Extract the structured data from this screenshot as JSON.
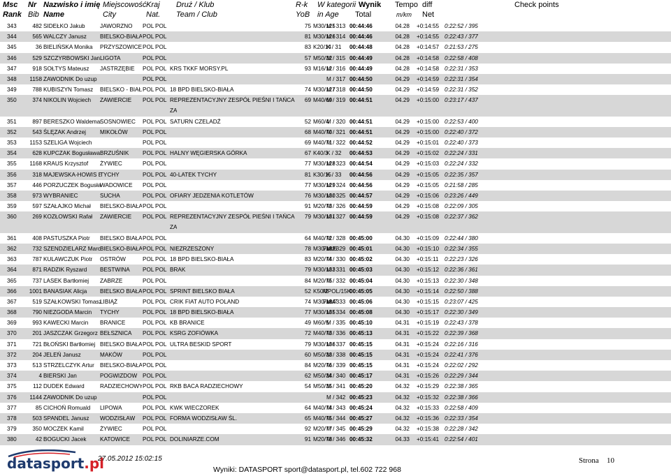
{
  "header": {
    "msc": "Msc",
    "nr": "Nr",
    "nazwisko": "Nazwisko i imię",
    "miejscowosc": "Miejscowość",
    "kraj": "Kraj",
    "druz": "Druż / Klub",
    "rk": "R-k",
    "wkat": "W kategorii",
    "wynik": "Wynik",
    "tempo": "Tempo",
    "diff": "diff",
    "check": "Check points",
    "rank": "Rank",
    "bib": "Bib",
    "name": "Name",
    "city": "City",
    "nat": "Nat.",
    "team": "Team / Club",
    "yob": "YoB",
    "inage": "in Age",
    "total": "Total",
    "mkm": "m/km",
    "net": "Net"
  },
  "rows": [
    {
      "rank": "343",
      "bib": "482",
      "name": "SIDEŁKO Jakub",
      "city": "JAWORZNO",
      "nat1": "POL",
      "nat2": "POL",
      "team": "",
      "team2": "",
      "yob": "75",
      "cat": "M30/125",
      "fiat": "",
      "age": "M / 313",
      "total": "00:44:46",
      "tempo": "04.28",
      "diff": "+0:14:55",
      "net": "0:22:52 / 395"
    },
    {
      "rank": "344",
      "bib": "565",
      "name": "WALCZY Janusz",
      "city": "BIELSKO-BIAŁA",
      "nat1": "POL",
      "nat2": "POL",
      "team": "",
      "team2": "",
      "yob": "81",
      "cat": "M30/126",
      "fiat": "",
      "age": "M / 314",
      "total": "00:44:46",
      "tempo": "04.28",
      "diff": "+0:14:55",
      "net": "0:22:43 / 377"
    },
    {
      "rank": "345",
      "bib": "36",
      "name": "BIELIŃSKA Monika",
      "city": "PRZYSZOWICE",
      "nat1": "POL",
      "nat2": "POL",
      "team": "",
      "team2": "",
      "yob": "83",
      "cat": "K20/14",
      "fiat": "",
      "age": "K / 31",
      "total": "00:44:48",
      "tempo": "04.28",
      "diff": "+0:14:57",
      "net": "0:21:53 / 275"
    },
    {
      "rank": "346",
      "bib": "529",
      "name": "SZCZYRBOWSKI Jan",
      "city": "LIGOTA",
      "nat1": "POL",
      "nat2": "POL",
      "team": "",
      "team2": "",
      "yob": "57",
      "cat": "M50/32",
      "fiat": "",
      "age": "M / 315",
      "total": "00:44:49",
      "tempo": "04.28",
      "diff": "+0:14:58",
      "net": "0:22:58 / 408"
    },
    {
      "rank": "347",
      "bib": "918",
      "name": "SOŁTYS Mateusz",
      "city": "JASTRZĘBIE",
      "nat1": "POL",
      "nat2": "POL",
      "team": "KRS TKKF MORSY.PL",
      "team2": "",
      "yob": "93",
      "cat": "M16/12",
      "fiat": "",
      "age": "M / 316",
      "total": "00:44:49",
      "tempo": "04.28",
      "diff": "+0:14:58",
      "net": "0:22:31 / 353"
    },
    {
      "rank": "348",
      "bib": "1158",
      "name": "ZAWODNIK Do uzup",
      "city": "",
      "nat1": "POL",
      "nat2": "POL",
      "team": "",
      "team2": "",
      "yob": "",
      "cat": "",
      "fiat": "",
      "age": "M / 317",
      "total": "00:44:50",
      "tempo": "04.29",
      "diff": "+0:14:59",
      "net": "0:22:31 / 354"
    },
    {
      "rank": "349",
      "bib": "788",
      "name": "KUBISZYN Tomasz",
      "city": "BIELSKO - BIAŁA",
      "nat1": "POL",
      "nat2": "POL",
      "team": "18 BPD BIELSKO-BIAŁA",
      "team2": "",
      "yob": "74",
      "cat": "M30/127",
      "fiat": "",
      "age": "M / 318",
      "total": "00:44:50",
      "tempo": "04.29",
      "diff": "+0:14:59",
      "net": "0:22:31 / 352"
    },
    {
      "rank": "350",
      "bib": "374",
      "name": "NIKOLIN Wojciech",
      "city": "ZAWIERCIE",
      "nat1": "POL",
      "nat2": "POL",
      "team": "REPREZENTACYJNY ZESPÓŁ PIEŚNI I TAŃCA",
      "team2": "ZA",
      "yob": "69",
      "cat": "M40/69",
      "fiat": "",
      "age": "M / 319",
      "total": "00:44:51",
      "tempo": "04.29",
      "diff": "+0:15:00",
      "net": "0:23:17 / 437"
    },
    {
      "rank": "351",
      "bib": "897",
      "name": "BERESZKO Waldemar",
      "city": "SOSNOWIEC",
      "nat1": "POL",
      "nat2": "POL",
      "team": "SATURN CZELADŹ",
      "team2": "",
      "yob": "52",
      "cat": "M60/4",
      "fiat": "",
      "age": "M / 320",
      "total": "00:44:51",
      "tempo": "04.29",
      "diff": "+0:15:00",
      "net": "0:22:53 / 400"
    },
    {
      "rank": "352",
      "bib": "543",
      "name": "ŚLĘZAK Andrzej",
      "city": "MIKOŁÓW",
      "nat1": "POL",
      "nat2": "POL",
      "team": "",
      "team2": "",
      "yob": "68",
      "cat": "M40/70",
      "fiat": "",
      "age": "M / 321",
      "total": "00:44:51",
      "tempo": "04.29",
      "diff": "+0:15:00",
      "net": "0:22:40 / 372"
    },
    {
      "rank": "353",
      "bib": "1153",
      "name": "SZELIGA Wojciech",
      "city": "",
      "nat1": "POL",
      "nat2": "POL",
      "team": "",
      "team2": "",
      "yob": "69",
      "cat": "M40/71",
      "fiat": "",
      "age": "M / 322",
      "total": "00:44:52",
      "tempo": "04.29",
      "diff": "+0:15:01",
      "net": "0:22:40 / 373"
    },
    {
      "rank": "354",
      "bib": "628",
      "name": "KUPCZAK Bogusława",
      "city": "BRZUŚNIK",
      "nat1": "POL",
      "nat2": "POL",
      "team": "HALNY WĘGIERSKA GÓRKA",
      "team2": "",
      "yob": "67",
      "cat": "K40/3",
      "fiat": "",
      "age": "K / 32",
      "total": "00:44:53",
      "tempo": "04.29",
      "diff": "+0:15:02",
      "net": "0:22:24 / 331"
    },
    {
      "rank": "355",
      "bib": "1168",
      "name": "KRAUS Krzysztof",
      "city": "ŻYWIEC",
      "nat1": "POL",
      "nat2": "POL",
      "team": "",
      "team2": "",
      "yob": "77",
      "cat": "M30/128",
      "fiat": "",
      "age": "M / 323",
      "total": "00:44:54",
      "tempo": "04.29",
      "diff": "+0:15:03",
      "net": "0:22:24 / 332"
    },
    {
      "rank": "356",
      "bib": "318",
      "name": "MAJEWSKA-HOWIS Ewelina",
      "city": "TYCHY",
      "nat1": "POL",
      "nat2": "POL",
      "team": "40-LATEK TYCHY",
      "team2": "",
      "yob": "81",
      "cat": "K30/15",
      "fiat": "",
      "age": "K / 33",
      "total": "00:44:56",
      "tempo": "04.29",
      "diff": "+0:15:05",
      "net": "0:22:35 / 357"
    },
    {
      "rank": "357",
      "bib": "446",
      "name": "PORZUCZEK Bogusław",
      "city": "WADOWICE",
      "nat1": "POL",
      "nat2": "POL",
      "team": "",
      "team2": "",
      "yob": "77",
      "cat": "M30/129",
      "fiat": "",
      "age": "M / 324",
      "total": "00:44:56",
      "tempo": "04.29",
      "diff": "+0:15:05",
      "net": "0:21:58 / 285"
    },
    {
      "rank": "358",
      "bib": "973",
      "name": "WYBRANIEC",
      "city": "SUCHA",
      "nat1": "POL",
      "nat2": "POL",
      "team": "OFIARY JEDZENIA KOTLETÓW",
      "team2": "",
      "yob": "76",
      "cat": "M30/130",
      "fiat": "",
      "age": "M / 325",
      "total": "00:44:57",
      "tempo": "04.29",
      "diff": "+0:15:06",
      "net": "0:23:26 / 449"
    },
    {
      "rank": "359",
      "bib": "597",
      "name": "SZAŁAJKO Michał",
      "city": "BIELSKO-BIAŁA",
      "nat1": "POL",
      "nat2": "POL",
      "team": "",
      "team2": "",
      "yob": "91",
      "cat": "M20/73",
      "fiat": "",
      "age": "M / 326",
      "total": "00:44:59",
      "tempo": "04.29",
      "diff": "+0:15:08",
      "net": "0:22:09 / 305"
    },
    {
      "rank": "360",
      "bib": "269",
      "name": "KOZŁOWSKI Rafał",
      "city": "ZAWIERCIE",
      "nat1": "POL",
      "nat2": "POL",
      "team": "REPREZENTACYJNY ZESPÓŁ PIEŚNI I TAŃCA",
      "team2": "ZA",
      "yob": "79",
      "cat": "M30/131",
      "fiat": "",
      "age": "M / 327",
      "total": "00:44:59",
      "tempo": "04.29",
      "diff": "+0:15:08",
      "net": "0:22:37 / 362"
    },
    {
      "rank": "361",
      "bib": "408",
      "name": "PASTUSZKA Piotr",
      "city": "BIELSKO BIAŁA",
      "nat1": "POL",
      "nat2": "POL",
      "team": "",
      "team2": "",
      "yob": "64",
      "cat": "M40/72",
      "fiat": "",
      "age": "M / 328",
      "total": "00:45:00",
      "tempo": "04.30",
      "diff": "+0:15:09",
      "net": "0:22:44 / 380"
    },
    {
      "rank": "362",
      "bib": "732",
      "name": "SZENDZIELARZ Marcin",
      "city": "BIELSKO-BIAŁA",
      "nat1": "POL",
      "nat2": "POL",
      "team": "NIEZRZESZONY",
      "team2": "",
      "yob": "78",
      "cat": "M30/132",
      "fiat": "Fiat/6",
      "age": "M / 329",
      "total": "00:45:01",
      "tempo": "04.30",
      "diff": "+0:15:10",
      "net": "0:22:34 / 355"
    },
    {
      "rank": "363",
      "bib": "787",
      "name": "KULAWCZUK Piotr",
      "city": "OSTRÓW",
      "nat1": "POL",
      "nat2": "POL",
      "team": "18 BPD BIELSKO-BIAŁA",
      "team2": "",
      "yob": "83",
      "cat": "M20/74",
      "fiat": "",
      "age": "M / 330",
      "total": "00:45:02",
      "tempo": "04.30",
      "diff": "+0:15:11",
      "net": "0:22:23 / 326"
    },
    {
      "rank": "364",
      "bib": "871",
      "name": "RADZIK Ryszard",
      "city": "BESTWINA",
      "nat1": "POL",
      "nat2": "POL",
      "team": "BRAK",
      "team2": "",
      "yob": "79",
      "cat": "M30/133",
      "fiat": "",
      "age": "M / 331",
      "total": "00:45:03",
      "tempo": "04.30",
      "diff": "+0:15:12",
      "net": "0:22:36 / 361"
    },
    {
      "rank": "365",
      "bib": "737",
      "name": "LASEK Bartłomiej",
      "city": "ZABRZE",
      "nat1": "POL",
      "nat2": "POL",
      "team": "",
      "team2": "",
      "yob": "84",
      "cat": "M20/75",
      "fiat": "",
      "age": "M / 332",
      "total": "00:45:04",
      "tempo": "04.30",
      "diff": "+0:15:13",
      "net": "0:22:30 / 348"
    },
    {
      "rank": "366",
      "bib": "1001",
      "name": "BANASIAK Alicja",
      "city": "BIELSKO BIAŁA",
      "nat1": "POL",
      "nat2": "POL",
      "team": "SPRINT BIELSKO BIAŁA",
      "team2": "",
      "yob": "52",
      "cat": "K50/2",
      "fiat": "MPOL/15K / 34",
      "age": "",
      "total": "00:45:05",
      "tempo": "04.30",
      "diff": "+0:15:14",
      "net": "0:22:50 / 388"
    },
    {
      "rank": "367",
      "bib": "519",
      "name": "SZAŁKOWSKI Tomasz",
      "city": "LIBIĄŻ",
      "nat1": "POL",
      "nat2": "POL",
      "team": "CRIK FIAT AUTO POLAND",
      "team2": "",
      "yob": "74",
      "cat": "M30/134",
      "fiat": "Fiat/7",
      "age": "M / 333",
      "total": "00:45:06",
      "tempo": "04.30",
      "diff": "+0:15:15",
      "net": "0:23:07 / 425"
    },
    {
      "rank": "368",
      "bib": "790",
      "name": "NIEZGODA Marcin",
      "city": "TYCHY",
      "nat1": "POL",
      "nat2": "POL",
      "team": "18 BPD BIELSKO-BIAŁA",
      "team2": "",
      "yob": "77",
      "cat": "M30/135",
      "fiat": "",
      "age": "M / 334",
      "total": "00:45:08",
      "tempo": "04.30",
      "diff": "+0:15:17",
      "net": "0:22:30 / 349"
    },
    {
      "rank": "369",
      "bib": "993",
      "name": "KAWECKI Marcin",
      "city": "BRANICE",
      "nat1": "POL",
      "nat2": "POL",
      "team": "KB BRANICE",
      "team2": "",
      "yob": "49",
      "cat": "M60/5",
      "fiat": "",
      "age": "M / 335",
      "total": "00:45:10",
      "tempo": "04.31",
      "diff": "+0:15:19",
      "net": "0:22:43 / 378"
    },
    {
      "rank": "370",
      "bib": "201",
      "name": "JASZCZAK Grzegorz",
      "city": "BEŁSZNICA",
      "nat1": "POL",
      "nat2": "POL",
      "team": "KSRG ZOFIÓWKA",
      "team2": "",
      "yob": "72",
      "cat": "M40/73",
      "fiat": "",
      "age": "M / 336",
      "total": "00:45:13",
      "tempo": "04.31",
      "diff": "+0:15:22",
      "net": "0:22:39 / 368"
    },
    {
      "rank": "371",
      "bib": "721",
      "name": "BŁOŃSKI Bartłomiej",
      "city": "BIELSKO BIAŁA",
      "nat1": "POL",
      "nat2": "POL",
      "team": "ULTRA BESKID SPORT",
      "team2": "",
      "yob": "79",
      "cat": "M30/136",
      "fiat": "",
      "age": "M / 337",
      "total": "00:45:15",
      "tempo": "04.31",
      "diff": "+0:15:24",
      "net": "0:22:16 / 316"
    },
    {
      "rank": "372",
      "bib": "204",
      "name": "JELEŃ Janusz",
      "city": "MAKÓW",
      "nat1": "POL",
      "nat2": "POL",
      "team": "",
      "team2": "",
      "yob": "60",
      "cat": "M50/33",
      "fiat": "",
      "age": "M / 338",
      "total": "00:45:15",
      "tempo": "04.31",
      "diff": "+0:15:24",
      "net": "0:22:41 / 376"
    },
    {
      "rank": "373",
      "bib": "513",
      "name": "STRZELCZYK Artur",
      "city": "BIELSKO-BIAŁA",
      "nat1": "POL",
      "nat2": "POL",
      "team": "",
      "team2": "",
      "yob": "84",
      "cat": "M20/76",
      "fiat": "",
      "age": "M / 339",
      "total": "00:45:15",
      "tempo": "04.31",
      "diff": "+0:15:24",
      "net": "0:22:02 / 292"
    },
    {
      "rank": "374",
      "bib": "4",
      "name": "BIERSKI Jan",
      "city": "POGWIZDOW",
      "nat1": "POL",
      "nat2": "POL",
      "team": "",
      "team2": "",
      "yob": "62",
      "cat": "M50/34",
      "fiat": "",
      "age": "M / 340",
      "total": "00:45:17",
      "tempo": "04.31",
      "diff": "+0:15:26",
      "net": "0:22:29 / 344"
    },
    {
      "rank": "375",
      "bib": "112",
      "name": "DUDEK Edward",
      "city": "RADZIECHOWY",
      "nat1": "POL",
      "nat2": "POL",
      "team": "RKB BACA RADZIECHOWY",
      "team2": "",
      "yob": "54",
      "cat": "M50/35",
      "fiat": "",
      "age": "M / 341",
      "total": "00:45:20",
      "tempo": "04.32",
      "diff": "+0:15:29",
      "net": "0:22:38 / 365"
    },
    {
      "rank": "376",
      "bib": "1144",
      "name": "ZAWODNIK Do uzup",
      "city": "",
      "nat1": "POL",
      "nat2": "POL",
      "team": "",
      "team2": "",
      "yob": "",
      "cat": "",
      "fiat": "",
      "age": "M / 342",
      "total": "00:45:23",
      "tempo": "04.32",
      "diff": "+0:15:32",
      "net": "0:22:38 / 366"
    },
    {
      "rank": "377",
      "bib": "85",
      "name": "CICHOŃ Romuald",
      "city": "LIPOWA",
      "nat1": "POL",
      "nat2": "POL",
      "team": "KWK WIECZOREK",
      "team2": "",
      "yob": "64",
      "cat": "M40/74",
      "fiat": "",
      "age": "M / 343",
      "total": "00:45:24",
      "tempo": "04.32",
      "diff": "+0:15:33",
      "net": "0:22:58 / 409"
    },
    {
      "rank": "378",
      "bib": "503",
      "name": "SPANDEL Janusz",
      "city": "WODZISŁAW",
      "nat1": "POL",
      "nat2": "POL",
      "team": "FORMA WODZISŁAW ŚL.",
      "team2": "",
      "yob": "65",
      "cat": "M40/75",
      "fiat": "",
      "age": "M / 344",
      "total": "00:45:27",
      "tempo": "04.32",
      "diff": "+0:15:36",
      "net": "0:22:33 / 354"
    },
    {
      "rank": "379",
      "bib": "350",
      "name": "MOCZEK Kamil",
      "city": "ŻYWIEC",
      "nat1": "POL",
      "nat2": "POL",
      "team": "",
      "team2": "",
      "yob": "92",
      "cat": "M20/77",
      "fiat": "",
      "age": "M / 345",
      "total": "00:45:29",
      "tempo": "04.32",
      "diff": "+0:15:38",
      "net": "0:22:28 / 342"
    },
    {
      "rank": "380",
      "bib": "42",
      "name": "BOGUCKI Jacek",
      "city": "KATOWICE",
      "nat1": "POL",
      "nat2": "POL",
      "team": "DOLINIARZE.COM",
      "team2": "",
      "yob": "91",
      "cat": "M20/78",
      "fiat": "",
      "age": "M / 346",
      "total": "00:45:32",
      "tempo": "04.33",
      "diff": "+0:15:41",
      "net": "0:22:54 / 401"
    }
  ],
  "footer": {
    "logo_main": "datasport",
    "logo_dot": ".pl",
    "timestamp": "27.05.2012 15:02:15",
    "wyniki": "Wyniki: DATASPORT sport@datasport.pl, tel.602 722 968",
    "strona": "Strona",
    "page": "10"
  },
  "colors": {
    "alt_row": "#d7d7d7",
    "logo_blue": "#1f3b6e",
    "logo_red": "#d62128"
  }
}
